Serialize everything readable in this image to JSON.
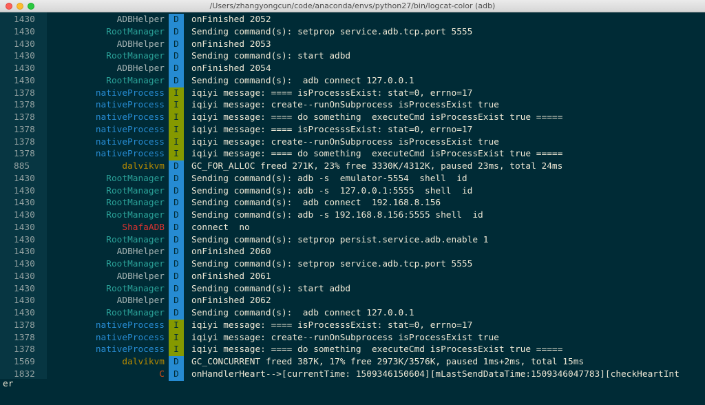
{
  "window": {
    "title": "/Users/zhangyongcun/code/anaconda/envs/python27/bin/logcat-color (adb)"
  },
  "colors": {
    "tags": {
      "ADBHelper": "#a5b3b3",
      "RootManager": "#2aa198",
      "nativeProcess": "#268bd2",
      "dalvikvm": "#b58900",
      "ShafaADB": "#dc322f",
      "C": "#cb4b16"
    },
    "levels": {
      "D": "#268bd2",
      "I": "#859900"
    }
  },
  "log": [
    {
      "pid": "1430",
      "tag": "ADBHelper",
      "level": "D",
      "msg": "onFinished 2052"
    },
    {
      "pid": "1430",
      "tag": "RootManager",
      "level": "D",
      "msg": "Sending command(s): setprop service.adb.tcp.port 5555"
    },
    {
      "pid": "1430",
      "tag": "ADBHelper",
      "level": "D",
      "msg": "onFinished 2053"
    },
    {
      "pid": "1430",
      "tag": "RootManager",
      "level": "D",
      "msg": "Sending command(s): start adbd"
    },
    {
      "pid": "1430",
      "tag": "ADBHelper",
      "level": "D",
      "msg": "onFinished 2054"
    },
    {
      "pid": "1430",
      "tag": "RootManager",
      "level": "D",
      "msg": "Sending command(s):  adb connect 127.0.0.1"
    },
    {
      "pid": "1378",
      "tag": "nativeProcess",
      "level": "I",
      "msg": "iqiyi message: ==== isProcesssExist: stat=0, errno=17"
    },
    {
      "pid": "1378",
      "tag": "nativeProcess",
      "level": "I",
      "msg": "iqiyi message: create--runOnSubprocess isProcessExist true"
    },
    {
      "pid": "1378",
      "tag": "nativeProcess",
      "level": "I",
      "msg": "iqiyi message: ==== do something  executeCmd isProcessExist true ====="
    },
    {
      "pid": "1378",
      "tag": "nativeProcess",
      "level": "I",
      "msg": "iqiyi message: ==== isProcesssExist: stat=0, errno=17"
    },
    {
      "pid": "1378",
      "tag": "nativeProcess",
      "level": "I",
      "msg": "iqiyi message: create--runOnSubprocess isProcessExist true"
    },
    {
      "pid": "1378",
      "tag": "nativeProcess",
      "level": "I",
      "msg": "iqiyi message: ==== do something  executeCmd isProcessExist true ====="
    },
    {
      "pid": "885",
      "tag": "dalvikvm",
      "level": "D",
      "msg": "GC_FOR_ALLOC freed 271K, 23% free 3330K/4312K, paused 23ms, total 24ms"
    },
    {
      "pid": "1430",
      "tag": "RootManager",
      "level": "D",
      "msg": "Sending command(s): adb -s  emulator-5554  shell  id"
    },
    {
      "pid": "1430",
      "tag": "RootManager",
      "level": "D",
      "msg": "Sending command(s): adb -s  127.0.0.1:5555  shell  id"
    },
    {
      "pid": "1430",
      "tag": "RootManager",
      "level": "D",
      "msg": "Sending command(s):  adb connect  192.168.8.156"
    },
    {
      "pid": "1430",
      "tag": "RootManager",
      "level": "D",
      "msg": "Sending command(s): adb -s 192.168.8.156:5555 shell  id"
    },
    {
      "pid": "1430",
      "tag": "ShafaADB",
      "level": "D",
      "msg": "connect  no"
    },
    {
      "pid": "1430",
      "tag": "RootManager",
      "level": "D",
      "msg": "Sending command(s): setprop persist.service.adb.enable 1"
    },
    {
      "pid": "1430",
      "tag": "ADBHelper",
      "level": "D",
      "msg": "onFinished 2060"
    },
    {
      "pid": "1430",
      "tag": "RootManager",
      "level": "D",
      "msg": "Sending command(s): setprop service.adb.tcp.port 5555"
    },
    {
      "pid": "1430",
      "tag": "ADBHelper",
      "level": "D",
      "msg": "onFinished 2061"
    },
    {
      "pid": "1430",
      "tag": "RootManager",
      "level": "D",
      "msg": "Sending command(s): start adbd"
    },
    {
      "pid": "1430",
      "tag": "ADBHelper",
      "level": "D",
      "msg": "onFinished 2062"
    },
    {
      "pid": "1430",
      "tag": "RootManager",
      "level": "D",
      "msg": "Sending command(s):  adb connect 127.0.0.1"
    },
    {
      "pid": "1378",
      "tag": "nativeProcess",
      "level": "I",
      "msg": "iqiyi message: ==== isProcesssExist: stat=0, errno=17"
    },
    {
      "pid": "1378",
      "tag": "nativeProcess",
      "level": "I",
      "msg": "iqiyi message: create--runOnSubprocess isProcessExist true"
    },
    {
      "pid": "1378",
      "tag": "nativeProcess",
      "level": "I",
      "msg": "iqiyi message: ==== do something  executeCmd isProcessExist true ====="
    },
    {
      "pid": "1569",
      "tag": "dalvikvm",
      "level": "D",
      "msg": "GC_CONCURRENT freed 387K, 17% free 2973K/3576K, paused 1ms+2ms, total 15ms"
    },
    {
      "pid": "1832",
      "tag": "C",
      "level": "D",
      "msg": "onHandlerHeart-->[currentTime: 1509346150604][mLastSendDataTime:1509346047783][checkHeartInt"
    }
  ],
  "wrapped_line": "er"
}
